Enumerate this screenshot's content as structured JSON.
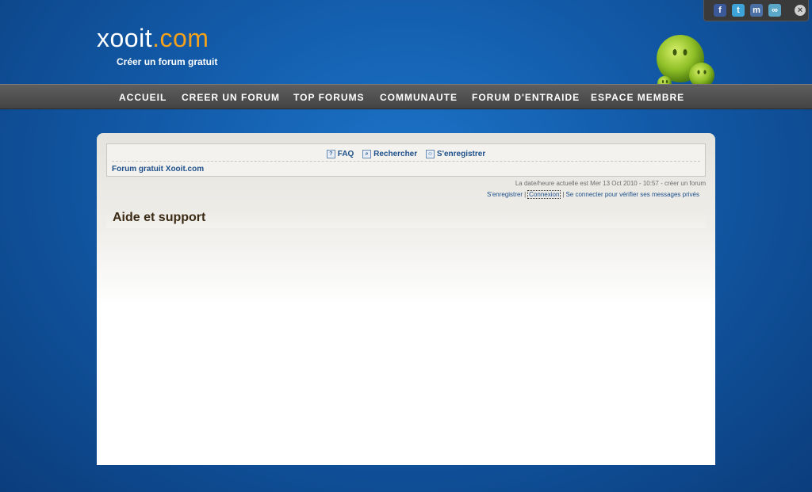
{
  "brand": {
    "logo_main": "xooit",
    "logo_dot": ".",
    "logo_tld": "com",
    "tagline": "Créer un forum gratuit"
  },
  "social": {
    "icons": [
      "facebook-icon",
      "twitter-icon",
      "myspace-icon",
      "share-icon"
    ],
    "close_icon": "close-icon"
  },
  "nav": {
    "items": [
      "ACCUEIL",
      "CREER UN FORUM",
      "TOP FORUMS",
      "COMMUNAUTE",
      "FORUM D'ENTRAIDE",
      "ESPACE MEMBRE"
    ]
  },
  "toplinks": {
    "faq": "FAQ",
    "search": "Rechercher",
    "register": "S'enregistrer"
  },
  "breadcrumb": "Forum gratuit Xooit.com",
  "datetime": "La date/heure actuelle est Mer 13 Oct 2010 - 10:57 - créer un forum",
  "userlinks": {
    "register": "S'enregistrer",
    "separator": "|",
    "login": "Connexion",
    "login_check": "Se connecter pour vérifier ses messages privés"
  },
  "page_title": "Aide et support",
  "colors": {
    "background_blue": "#125aa8",
    "nav_gray": "#4f4f4f",
    "logo_accent": "#f4a21c",
    "link_blue": "#1d4f8a",
    "title_brown": "#3b2a14"
  }
}
